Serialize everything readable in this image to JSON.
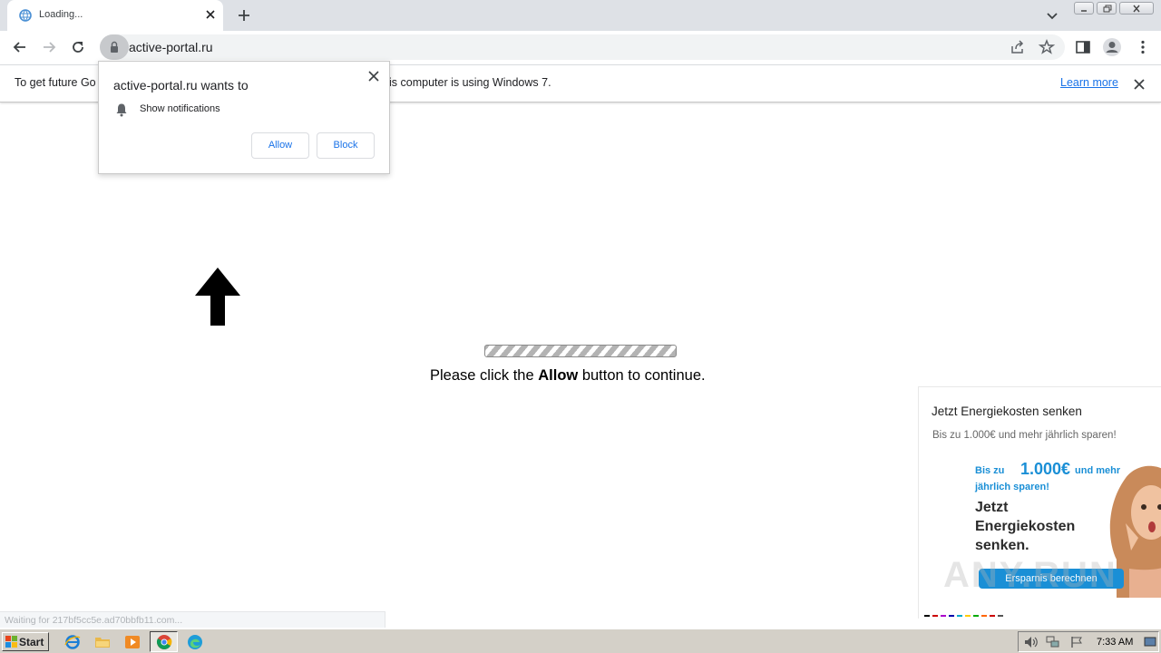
{
  "browser": {
    "tab_title": "Loading...",
    "url": "active-portal.ru"
  },
  "infobar": {
    "text_left": "To get future Go",
    "text_right": "is computer is using Windows 7.",
    "learn_more": "Learn more"
  },
  "permission_prompt": {
    "title": "active-portal.ru wants to",
    "permission": "Show notifications",
    "allow_label": "Allow",
    "block_label": "Block"
  },
  "page": {
    "instruction_pre": "Please click the ",
    "instruction_bold": "Allow",
    "instruction_post": " button to continue."
  },
  "ad": {
    "title": "Jetzt Energiekosten senken",
    "subtitle": "Bis zu 1.000€ und mehr jährlich sparen!",
    "banner_l1": "Bis zu",
    "banner_big": "1.000€",
    "banner_l1b": "und mehr",
    "banner_l2": "jährlich sparen!",
    "banner_h1": "Jetzt",
    "banner_h2": "Energiekosten",
    "banner_h3": "senken.",
    "cta": "Ersparnis berechnen"
  },
  "watermark": "ANY.RUN",
  "status": "Waiting for 217bf5cc5e.ad70bbfb11.com...",
  "taskbar": {
    "start_label": "Start",
    "clock": "7:33 AM"
  },
  "icons": [
    "globe-favicon-icon",
    "close-icon",
    "plus-icon",
    "chevron-down-icon",
    "back-icon",
    "forward-icon",
    "reload-icon",
    "lock-icon",
    "share-icon",
    "star-icon",
    "side-panel-icon",
    "profile-icon",
    "more-icon",
    "bell-icon",
    "up-arrow-icon"
  ],
  "colors": {
    "link": "#1a73e8",
    "tabstrip": "#dee1e6",
    "taskbar": "#d4d0c8",
    "ad_blue": "#1a8fd6"
  }
}
